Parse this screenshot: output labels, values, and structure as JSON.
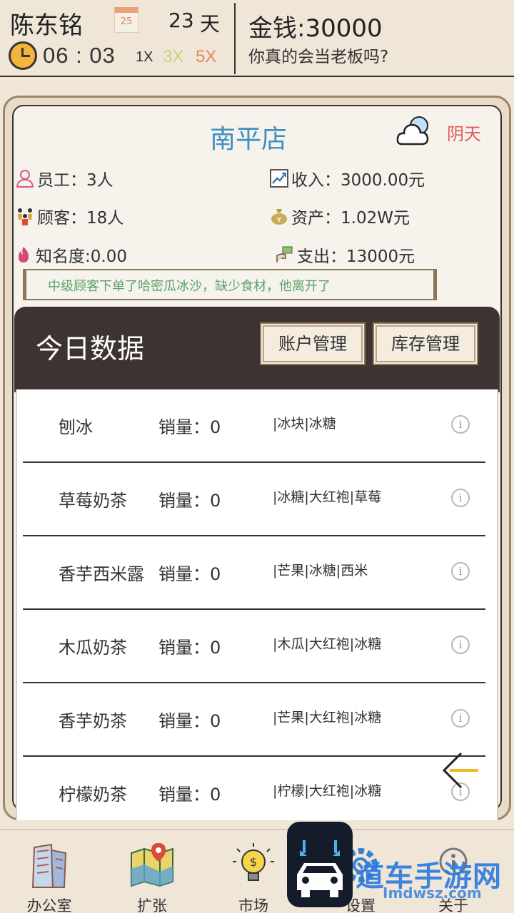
{
  "header": {
    "player_name": "陈东铭",
    "calendar_day": "25",
    "day_value": "23",
    "day_unit": "天",
    "clock": "06 : 03",
    "speeds": [
      "1X",
      "3X",
      "5X"
    ],
    "money": "金钱:30000",
    "slogan": "你真的会当老板吗?"
  },
  "store": {
    "name": "南平店",
    "weather": "阴天",
    "staff": "员工：3人",
    "income": "收入：3000.00元",
    "customers": "顾客：18人",
    "assets": "资产：1.02W元",
    "fame": "知名度:0.00",
    "expense": "支出：13000元",
    "notice": "中级顾客下单了哈密瓜冰沙，缺少食材，他离开了"
  },
  "data_panel": {
    "title": "今日数据",
    "account_button": "账户管理",
    "stock_button": "库存管理",
    "info_glyph": "i",
    "rows": [
      {
        "name": "刨冰",
        "sales": "销量：0",
        "ingredients": "|冰块|冰糖"
      },
      {
        "name": "草莓奶茶",
        "sales": "销量：0",
        "ingredients": "|冰糖|大红袍|草莓"
      },
      {
        "name": "香芋西米露",
        "sales": "销量：0",
        "ingredients": "|芒果|冰糖|西米"
      },
      {
        "name": "木瓜奶茶",
        "sales": "销量：0",
        "ingredients": "|木瓜|大红袍|冰糖"
      },
      {
        "name": "香芋奶茶",
        "sales": "销量：0",
        "ingredients": "|芒果|大红袍|冰糖"
      },
      {
        "name": "柠檬奶茶",
        "sales": "销量：0",
        "ingredients": "|柠檬|大红袍|冰糖"
      }
    ]
  },
  "bottom_nav": {
    "office": "办公室",
    "expand": "扩张",
    "market": "市场",
    "settings": "设置",
    "about": "关于"
  },
  "watermark": {
    "main": "道车手游网",
    "sub": "Imdwsz.com"
  },
  "colors": {
    "store_name": "#3e8fc4",
    "weather": "#e05a5a",
    "notice": "#5aa36d",
    "speed_3x": "#c9d27a",
    "speed_5x": "#e28a59",
    "header_dark": "#3d3432"
  }
}
